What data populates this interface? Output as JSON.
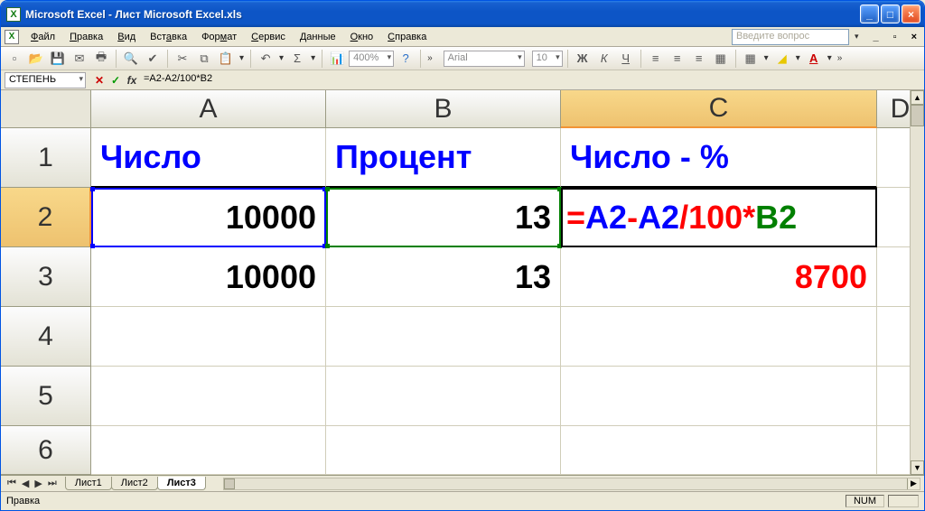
{
  "title": "Microsoft Excel - Лист Microsoft Excel.xls",
  "menu": {
    "file": "Файл",
    "edit": "Правка",
    "view": "Вид",
    "insert": "Вставка",
    "format": "Формат",
    "tools": "Сервис",
    "data": "Данные",
    "window": "Окно",
    "help": "Справка"
  },
  "helpbox_placeholder": "Введите вопрос",
  "format_toolbar": {
    "font": "Arial",
    "size": "10",
    "zoom": "400%"
  },
  "formulabar": {
    "namebox": "СТЕПЕНЬ",
    "formula": "=A2-A2/100*B2"
  },
  "columns": {
    "A": "A",
    "B": "B",
    "C": "C",
    "D": "D"
  },
  "rows": {
    "r1": "1",
    "r2": "2",
    "r3": "3",
    "r4": "4",
    "r5": "5",
    "r6": "6"
  },
  "cells": {
    "A1": "Число",
    "B1": "Процент",
    "C1": "Число - %",
    "A2": "10000",
    "B2": "13",
    "C2_parts": {
      "eq": "=",
      "a2a": "A2",
      "minus": "-",
      "a2b": "A2",
      "div100star": "/100*",
      "b2": "B2"
    },
    "A3": "10000",
    "B3": "13",
    "C3": "8700"
  },
  "sheets": {
    "s1": "Лист1",
    "s2": "Лист2",
    "s3": "Лист3"
  },
  "status": {
    "mode": "Правка",
    "num": "NUM"
  }
}
